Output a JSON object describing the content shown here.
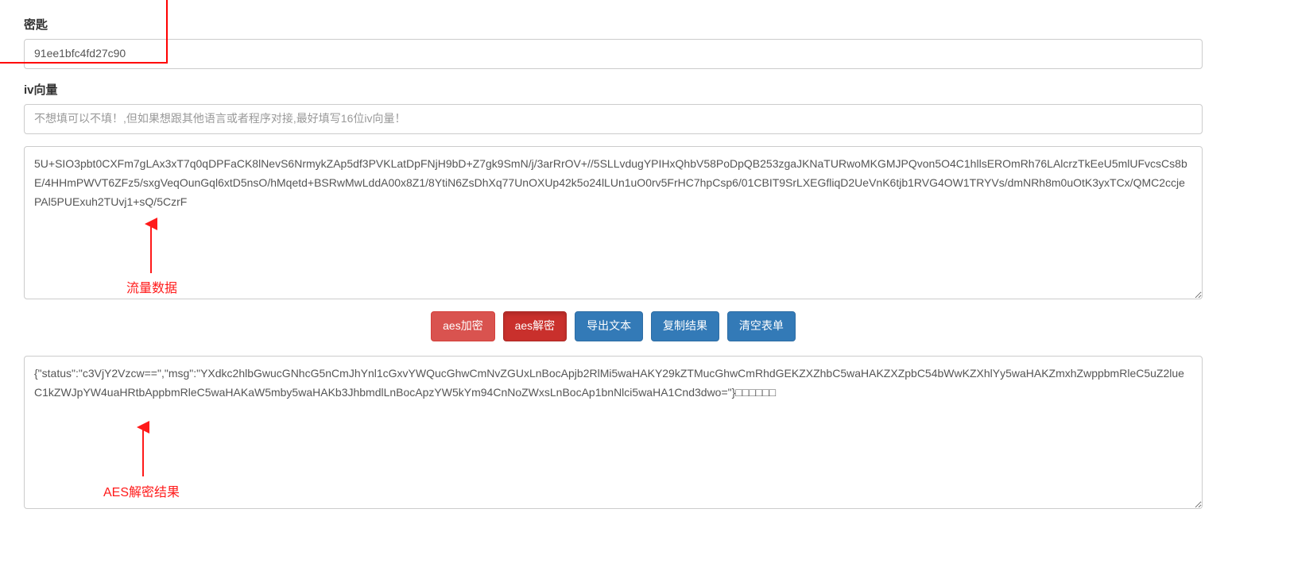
{
  "fields": {
    "key": {
      "label": "密匙",
      "value": "91ee1bfc4fd27c90"
    },
    "iv": {
      "label": "iv向量",
      "placeholder": "不想填可以不填！,但如果想跟其他语言或者程序对接,最好填写16位iv向量！"
    },
    "input_text": {
      "value": "5U+SIO3pbt0CXFm7gLAx3xT7q0qDPFaCK8lNevS6NrmykZAp5df3PVKLatDpFNjH9bD+Z7gk9SmN/j/3arRrOV+//5SLLvdugYPIHxQhbV58PoDpQB253zgaJKNaTURwoMKGMJPQvon5O4C1hllsEROmRh76LAlcrzTkEeU5mlUFvcsCs8bE/4HHmPWVT6ZFz5/sxgVeqOunGql6xtD5nsO/hMqetd+BSRwMwLddA00x8Z1/8YtiN6ZsDhXq77UnOXUp42k5o24lLUn1uO0rv5FrHC7hpCsp6/01CBIT9SrLXEGfliqD2UeVnK6tjb1RVG4OW1TRYVs/dmNRh8m0uOtK3yxTCx/QMC2ccjePAl5PUExuh2TUvj1+sQ/5CzrF"
    },
    "output_text": {
      "value": "{\"status\":\"c3VjY2Vzcw==\",\"msg\":\"YXdkc2hlbGwucGNhcG5nCmJhYnl1cGxvYWQucGhwCmNvZGUxLnBocApjb2RlMi5waHAKY29kZTMucGhwCmRhdGEKZXZhbC5waHAKZXZpbC54bWwKZXhlYy5waHAKZmxhZwppbmRleC5uZ2lueC1kZWJpYW4uaHRtbAppbmRleC5waHAKaW5mby5waHAKb3JhbmdlLnBocApzYW5kYm94CnNoZWxsLnBocAp1bnNlci5waHA1Cnd3dwo=\"}□□□□□□"
    }
  },
  "buttons": {
    "encrypt": "aes加密",
    "decrypt": "aes解密",
    "export": "导出文本",
    "copy": "复制结果",
    "clear": "清空表单"
  },
  "annotations": {
    "traffic_data": "流量数据",
    "aes_result": "AES解密结果"
  }
}
